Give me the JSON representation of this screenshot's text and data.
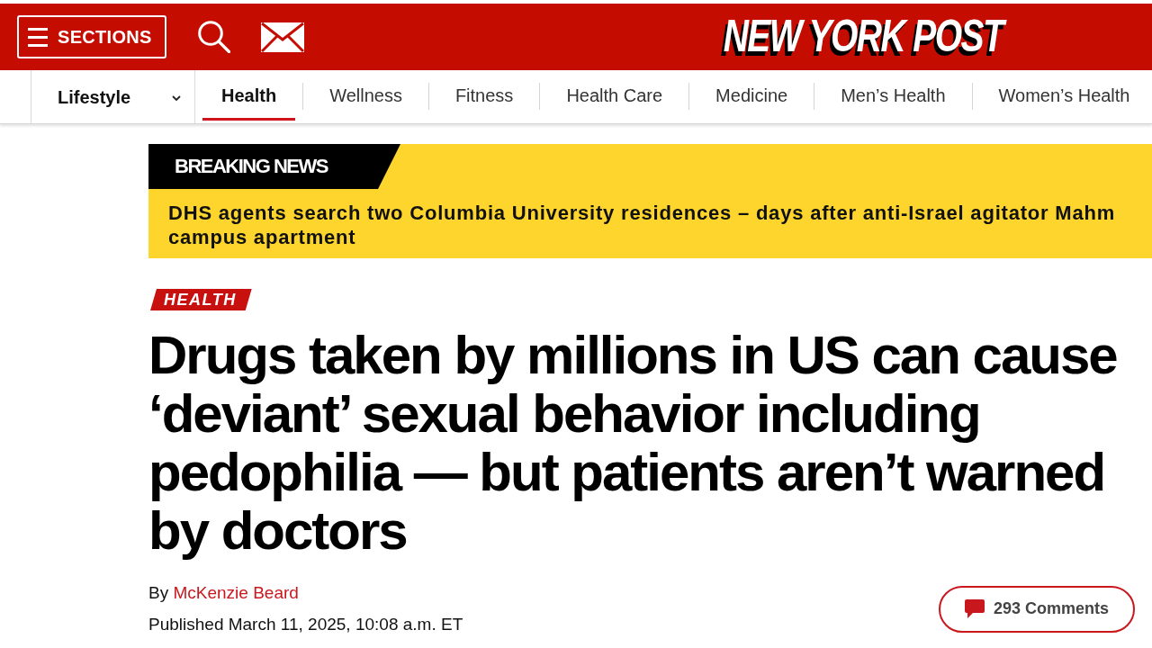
{
  "header": {
    "sections_button": {
      "label": "SECTIONS"
    },
    "logo": "NEW YORK POST"
  },
  "subnav": {
    "section_dropdown": {
      "label": "Lifestyle"
    },
    "tabs": [
      {
        "label": "Health",
        "selected": true
      },
      {
        "label": "Wellness",
        "selected": false
      },
      {
        "label": "Fitness",
        "selected": false
      },
      {
        "label": "Health Care",
        "selected": false
      },
      {
        "label": "Medicine",
        "selected": false
      },
      {
        "label": "Men’s Health",
        "selected": false
      },
      {
        "label": "Women’s Health",
        "selected": false
      }
    ]
  },
  "breaking_news": {
    "label": "BREAKING NEWS",
    "headline": "DHS agents search two Columbia University residences – days after anti-Israel agitator Mahm\ncampus apartment"
  },
  "article": {
    "category": "HEALTH",
    "headline": "Drugs taken by millions in US can cause ‘deviant’ sexual behavior including pedophilia — but patients aren’t warned by doctors",
    "byline": {
      "prefix": "By",
      "author": "McKenzie Beard"
    },
    "published": "Published March 11, 2025, 10:08 a.m. ET",
    "comments": {
      "label": "293 Comments"
    }
  }
}
